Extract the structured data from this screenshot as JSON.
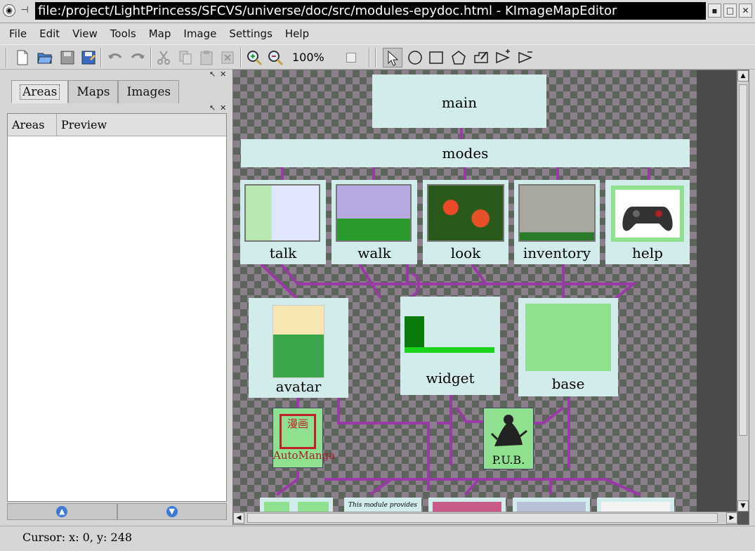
{
  "window": {
    "title": "file:/project/LightPrincess/SFCVS/universe/doc/src/modules-epydoc.html - KImageMapEditor"
  },
  "menu": [
    "File",
    "Edit",
    "View",
    "Tools",
    "Map",
    "Image",
    "Settings",
    "Help"
  ],
  "toolbar": {
    "zoom": "100%",
    "icons": [
      "new-icon",
      "open-icon",
      "save-icon",
      "save-as-icon",
      "undo-icon",
      "redo-icon",
      "cut-icon",
      "copy-icon",
      "paste-icon",
      "delete-icon",
      "zoom-in-icon",
      "zoom-out-icon",
      "select-icon",
      "circle-icon",
      "rectangle-icon",
      "polygon-icon",
      "freehand-icon",
      "add-point-icon",
      "remove-point-icon"
    ]
  },
  "dock": {
    "tabs": [
      "Areas",
      "Maps",
      "Images"
    ],
    "active_tab": "Areas",
    "columns": [
      "Areas",
      "Preview"
    ]
  },
  "diagram": {
    "main": "main",
    "modes": "modes",
    "modes_children": [
      "talk",
      "walk",
      "look",
      "inventory",
      "help"
    ],
    "components": [
      "avatar",
      "widget",
      "base"
    ],
    "logos": [
      "AutoManga",
      "P.U.B."
    ],
    "lower_thumb_text": "This module provides"
  },
  "status": {
    "cursor": "Cursor: x: 0, y: 248"
  },
  "colors": {
    "box": "#d2ecec",
    "connector": "#9a3aa6",
    "logo": "#8fe08f"
  }
}
